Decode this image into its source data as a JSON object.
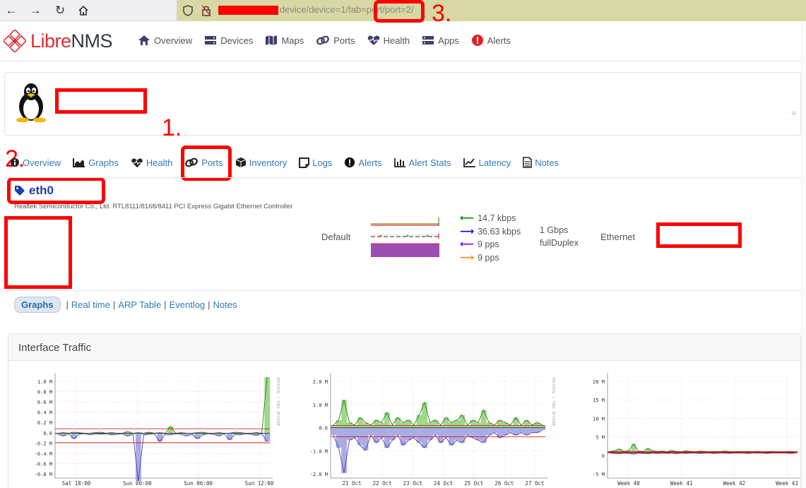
{
  "browser": {
    "url_visible": "device/device=1/tab=port/port=2/"
  },
  "brand": {
    "libre": "Libre",
    "nms": "NMS"
  },
  "nav": {
    "items": [
      {
        "label": "Overview",
        "icon": "home-icon"
      },
      {
        "label": "Devices",
        "icon": "server-icon"
      },
      {
        "label": "Maps",
        "icon": "map-icon"
      },
      {
        "label": "Ports",
        "icon": "link-icon"
      },
      {
        "label": "Health",
        "icon": "heartbeat-icon"
      },
      {
        "label": "Apps",
        "icon": "apps-icon"
      },
      {
        "label": "Alerts",
        "icon": "alert-circle-icon"
      }
    ]
  },
  "device_tabs": [
    {
      "label": "Overview",
      "icon": "info-icon"
    },
    {
      "label": "Graphs",
      "icon": "area-chart-icon"
    },
    {
      "label": "Health",
      "icon": "heartbeat-icon"
    },
    {
      "label": "Ports",
      "icon": "link-icon"
    },
    {
      "label": "Inventory",
      "icon": "cube-icon"
    },
    {
      "label": "Logs",
      "icon": "sticky-note-icon"
    },
    {
      "label": "Alerts",
      "icon": "alert-circle-icon"
    },
    {
      "label": "Alert Stats",
      "icon": "bar-chart-icon"
    },
    {
      "label": "Latency",
      "icon": "line-chart-icon"
    },
    {
      "label": "Notes",
      "icon": "file-text-icon"
    }
  ],
  "annotations": {
    "one": "1.",
    "two": "2.",
    "three": "3."
  },
  "port": {
    "name": "eth0",
    "description": "Realtek Semiconductor Co., Ltd. RTL8111/8168/8411 PCI Express Gigabit Ethernet Controller",
    "vlan": "Default",
    "in_rate": "14.7 kbps",
    "out_rate": "36.63 kbps",
    "in_pps": "9 pps",
    "out_pps": "9 pps",
    "speed": "1 Gbps",
    "duplex": "fullDuplex",
    "media": "Ethernet"
  },
  "subnav": {
    "graphs": "Graphs",
    "realtime": "Real time",
    "arp": "ARP Table",
    "eventlog": "Eventlog",
    "notes": "Notes",
    "sep": "|"
  },
  "traffic": {
    "title": "Interface Traffic",
    "side_label": "PROTOCOL / TOBI OETIKER"
  },
  "colors": {
    "in": "#008C00",
    "out": "#0000FF",
    "in_pps": "#7F00FF",
    "out_pps": "#FF8C00",
    "redact": "#FF0000"
  },
  "chart_data": [
    {
      "type": "area",
      "ylim": [
        -0.8,
        1.0
      ],
      "yticks": [
        "1.0 M",
        "0.8 M",
        "0.6 M",
        "0.4 M",
        "0.2 M",
        "0.0",
        "-0.2 M",
        "-0.4 M",
        "-0.6 M",
        "-0.8 M"
      ],
      "xticks": [
        "Sat 18:00",
        "Sun 00:00",
        "Sun 06:00",
        "Sun 12:00"
      ],
      "series": [
        {
          "values": [
            0.0,
            0.01,
            0.0,
            0.02,
            0.01,
            0.0,
            0.0,
            0.01,
            0.02,
            0.0,
            0.01,
            0.0,
            0.0,
            0.03,
            0.0,
            0.01,
            0.0,
            0.02,
            0.0,
            0.01,
            0.0,
            0.12,
            0.0,
            0.01,
            0.0,
            0.0,
            0.01,
            0.02,
            0.0,
            0.0,
            0.01,
            0.0,
            0.0,
            0.02,
            0.01,
            0.0,
            0.0,
            0.01,
            0.0,
            1.0
          ]
        },
        {
          "values": [
            -0.02,
            -0.05,
            -0.01,
            -0.1,
            -0.02,
            -0.01,
            -0.03,
            -0.01,
            -0.02,
            -0.01,
            -0.03,
            -0.02,
            -0.01,
            -0.05,
            -0.02,
            -0.85,
            -0.03,
            -0.02,
            -0.01,
            -0.15,
            -0.02,
            -0.03,
            -0.01,
            -0.02,
            -0.05,
            -0.02,
            -0.1,
            -0.03,
            -0.01,
            -0.02,
            -0.05,
            -0.01,
            -0.12,
            -0.02,
            -0.03,
            -0.01,
            -0.02,
            -0.04,
            -0.01,
            -0.15
          ]
        }
      ]
    },
    {
      "type": "area",
      "ylim": [
        -2.0,
        2.0
      ],
      "yticks": [
        "2.0 M",
        "1.0 M",
        "0.0",
        "-1.0 M",
        "-2.0 M"
      ],
      "xticks": [
        "21 Oct",
        "22 Oct",
        "23 Oct",
        "24 Oct",
        "25 Oct",
        "26 Oct",
        "27 Oct"
      ],
      "series": [
        {
          "values": [
            0.1,
            0.3,
            1.1,
            0.2,
            0.1,
            0.4,
            0.2,
            0.1,
            0.3,
            0.2,
            0.6,
            0.1,
            0.4,
            0.2,
            0.3,
            0.1,
            0.5,
            1.0,
            0.2,
            0.3,
            0.1,
            0.4,
            0.2,
            0.3,
            0.5,
            0.1,
            0.3,
            0.2,
            0.7,
            0.2,
            0.1,
            0.3,
            0.2,
            0.1,
            0.4,
            0.1,
            0.3,
            0.1,
            0.2,
            0.1
          ]
        },
        {
          "values": [
            -0.3,
            -0.8,
            -1.8,
            -0.5,
            -0.4,
            -0.7,
            -0.9,
            -0.3,
            -0.6,
            -0.4,
            -0.8,
            -0.5,
            -0.3,
            -0.7,
            -0.5,
            -0.4,
            -0.6,
            -0.8,
            -0.5,
            -0.3,
            -0.6,
            -0.4,
            -0.7,
            -0.5,
            -0.6,
            -0.3,
            -0.4,
            -0.5,
            -0.6,
            -0.3,
            -0.2,
            -0.4,
            -0.3,
            -0.2,
            -0.3,
            -0.2,
            -0.3,
            -0.2,
            -0.2,
            -0.1
          ]
        }
      ]
    },
    {
      "type": "area",
      "ylim": [
        -7.5,
        22
      ],
      "yticks": [
        "20 M",
        "15 M",
        "10 M",
        "5 M",
        "0",
        "-5 M"
      ],
      "xticks": [
        "Week 40",
        "Week 41",
        "Week 42",
        "Week 43"
      ],
      "series": [
        {
          "values": [
            0.3,
            0.5,
            1.0,
            0.3,
            0.6,
            2.5,
            0.4,
            0.3,
            1.2,
            0.5,
            0.3,
            0.4,
            0.2,
            0.6,
            0.3,
            0.2,
            0.5,
            0.3,
            0.2,
            0.4,
            0.3,
            0.2,
            0.3,
            0.2,
            0.4,
            0.3,
            0.2,
            0.3,
            0.2,
            0.3,
            0.2,
            0.3,
            0.2,
            0.2,
            0.3,
            0.2,
            0.2,
            0.2,
            0.3,
            0.2
          ]
        },
        {
          "values": [
            -0.2,
            -0.3,
            -0.4,
            -0.2,
            -0.3,
            -0.5,
            -0.2,
            -0.3,
            -0.4,
            -0.2,
            -0.3,
            -0.2,
            -0.3,
            -0.2,
            -0.4,
            -0.2,
            -0.3,
            -0.2,
            -0.2,
            -0.3,
            -0.2,
            -0.2,
            -0.3,
            -0.2,
            -0.2,
            -0.3,
            -0.2,
            -0.2,
            -0.2,
            -0.3,
            -0.2,
            -0.2,
            -0.2,
            -0.3,
            -0.2,
            -0.2,
            -0.2,
            -0.2,
            -0.3,
            -0.2
          ]
        }
      ]
    }
  ]
}
